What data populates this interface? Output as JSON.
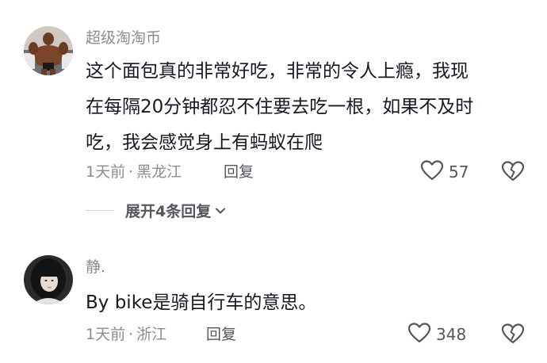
{
  "comments": [
    {
      "username": "超级淘淘币",
      "content_lines": [
        "这个面包真的非常好吃，非常的令人上瘾，我现",
        "在每隔20分钟都忍不住要去吃一根，如果不及时",
        "吃，我会感觉身上有蚂蚁在爬"
      ],
      "time": "1天前",
      "separator": "·",
      "location": "黑龙江",
      "reply_label": "回复",
      "like_count": "57",
      "expand_label": "展开4条回复"
    },
    {
      "username": "静.",
      "content_lines": [
        "By bike是骑自行车的意思。"
      ],
      "time": "1天前",
      "separator": "·",
      "location": "浙江",
      "reply_label": "回复",
      "like_count": "348"
    }
  ],
  "icons": {
    "like": "heart-outline-icon",
    "dislike": "broken-heart-outline-icon",
    "expand": "chevron-down-icon"
  },
  "colors": {
    "primary_text": "#161823",
    "secondary_text": "#8a8b91",
    "action_text": "#55565c"
  }
}
